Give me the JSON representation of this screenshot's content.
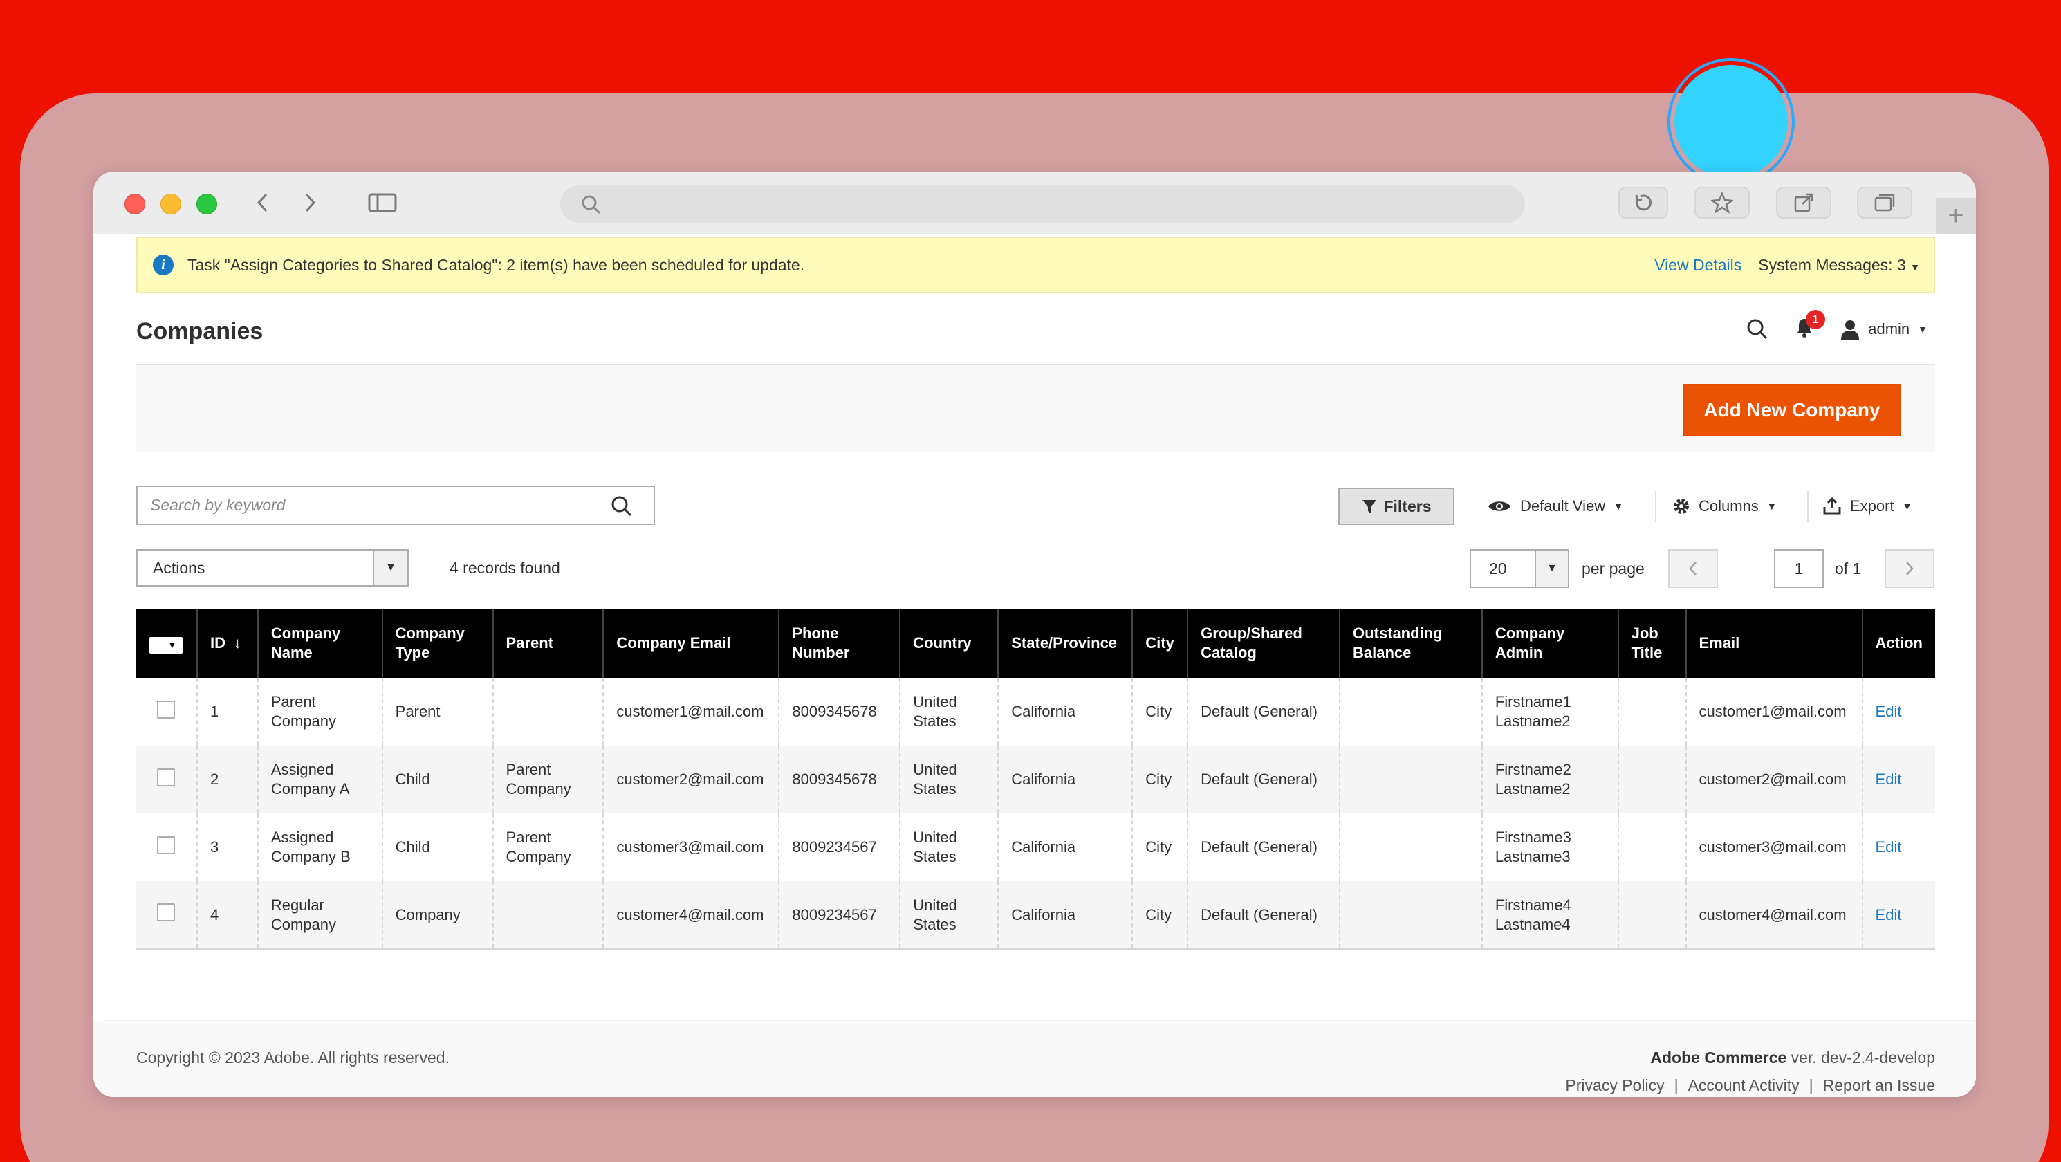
{
  "notice": {
    "message": "Task \"Assign Categories to Shared Catalog\": 2 item(s) have been scheduled for update.",
    "view_details": "View Details",
    "system_messages": "System Messages: 3"
  },
  "header": {
    "title": "Companies",
    "notification_count": "1",
    "user": "admin"
  },
  "toolbar": {
    "add_button": "Add New Company",
    "search_placeholder": "Search by keyword",
    "filters": "Filters",
    "view": "Default View",
    "columns": "Columns",
    "export": "Export",
    "actions": "Actions",
    "records": "4 records found",
    "per_page_value": "20",
    "per_page_label": "per page",
    "page": "1",
    "page_of": "of 1"
  },
  "table": {
    "headers": {
      "id": "ID",
      "company_name": [
        "Company",
        "Name"
      ],
      "company_type": [
        "Company",
        "Type"
      ],
      "parent": "Parent",
      "company_email": "Company Email",
      "phone": [
        "Phone",
        "Number"
      ],
      "country": "Country",
      "state": "State/Province",
      "city": "City",
      "group": [
        "Group/Shared",
        "Catalog"
      ],
      "balance": [
        "Outstanding",
        "Balance"
      ],
      "admin": [
        "Company",
        "Admin"
      ],
      "job_title": [
        "Job",
        "Title"
      ],
      "email": "Email",
      "action": "Action"
    },
    "rows": [
      {
        "id": "1",
        "name": [
          "Parent",
          "Company"
        ],
        "type": "Parent",
        "parent": [
          "",
          ""
        ],
        "company_email": "customer1@mail.com",
        "phone": "8009345678",
        "country": [
          "United",
          "States"
        ],
        "state": "California",
        "city": "City",
        "group": "Default (General)",
        "balance": "",
        "admin": [
          "Firstname1",
          "Lastname2"
        ],
        "job_title": "",
        "email": "customer1@mail.com",
        "action": "Edit"
      },
      {
        "id": "2",
        "name": [
          "Assigned",
          "Company A"
        ],
        "type": "Child",
        "parent": [
          "Parent",
          "Company"
        ],
        "company_email": "customer2@mail.com",
        "phone": "8009345678",
        "country": [
          "United",
          "States"
        ],
        "state": "California",
        "city": "City",
        "group": "Default (General)",
        "balance": "",
        "admin": [
          "Firstname2",
          "Lastname2"
        ],
        "job_title": "",
        "email": "customer2@mail.com",
        "action": "Edit"
      },
      {
        "id": "3",
        "name": [
          "Assigned",
          "Company B"
        ],
        "type": "Child",
        "parent": [
          "Parent",
          "Company"
        ],
        "company_email": "customer3@mail.com",
        "phone": "8009234567",
        "country": [
          "United",
          "States"
        ],
        "state": "California",
        "city": "City",
        "group": "Default (General)",
        "balance": "",
        "admin": [
          "Firstname3",
          "Lastname3"
        ],
        "job_title": "",
        "email": "customer3@mail.com",
        "action": "Edit"
      },
      {
        "id": "4",
        "name": [
          "Regular",
          "Company"
        ],
        "type": "Company",
        "parent": [
          "",
          ""
        ],
        "company_email": "customer4@mail.com",
        "phone": "8009234567",
        "country": [
          "United",
          "States"
        ],
        "state": "California",
        "city": "City",
        "group": "Default (General)",
        "balance": "",
        "admin": [
          "Firstname4",
          "Lastname4"
        ],
        "job_title": "",
        "email": "customer4@mail.com",
        "action": "Edit"
      }
    ]
  },
  "footer": {
    "copyright": "Copyright © 2023 Adobe. All rights reserved.",
    "brand": "Adobe Commerce",
    "version": " ver. dev-2.4-develop",
    "links": [
      "Privacy Policy",
      "Account Activity",
      "Report an Issue"
    ]
  },
  "colors": {
    "accent": "#eb5202",
    "link": "#1979c3",
    "background": "#ee1100"
  }
}
